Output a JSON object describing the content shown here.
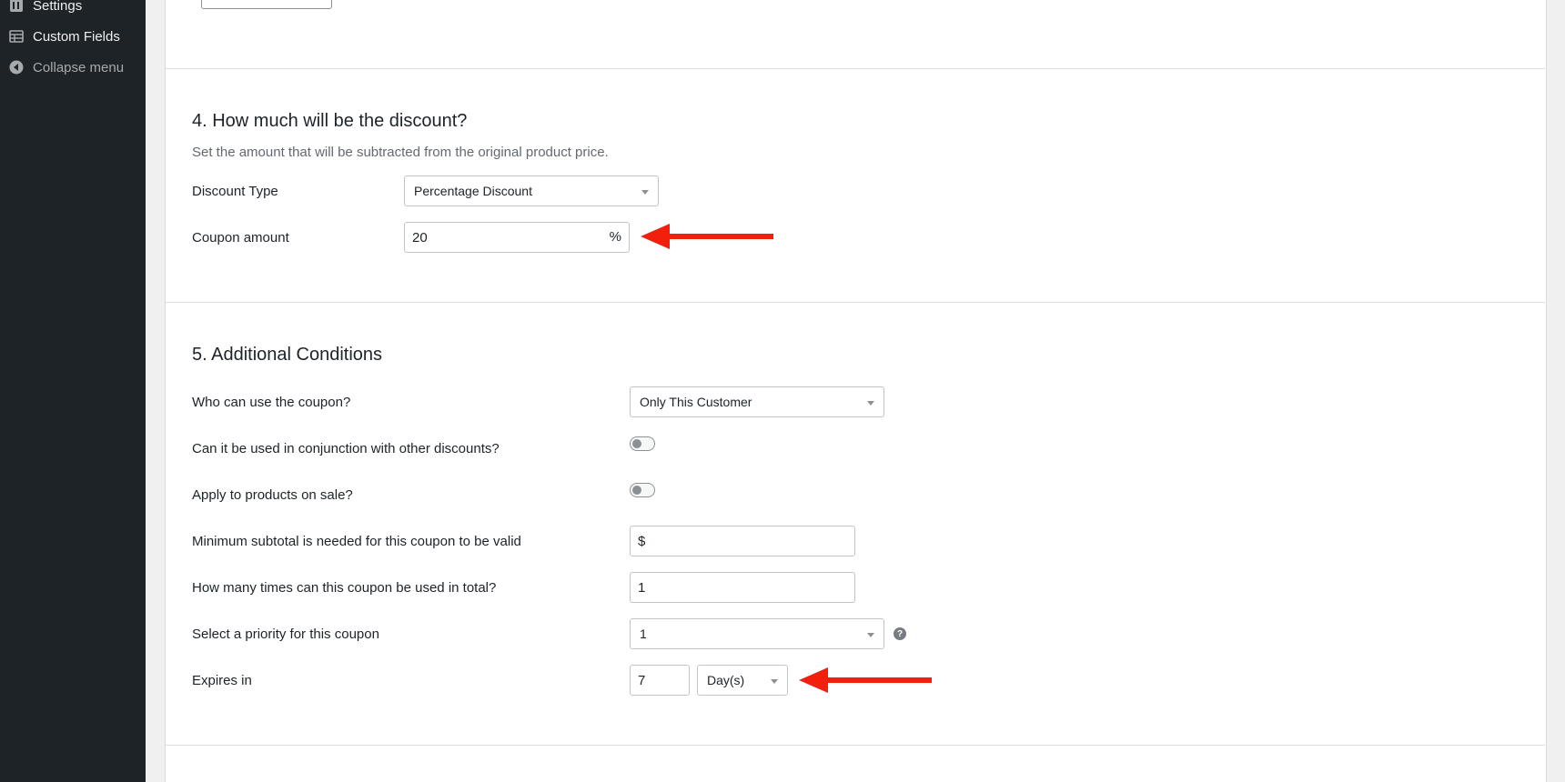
{
  "sidebar": {
    "items": [
      {
        "label": "Settings",
        "icon": "settings-icon"
      },
      {
        "label": "Custom Fields",
        "icon": "custom-fields-icon"
      },
      {
        "label": "Collapse menu",
        "icon": "collapse-icon"
      }
    ]
  },
  "section4": {
    "title": "4. How much will be the discount?",
    "description": "Set the amount that will be subtracted from the original product price.",
    "discount_type_label": "Discount Type",
    "discount_type_value": "Percentage Discount",
    "coupon_amount_label": "Coupon amount",
    "coupon_amount_value": "20",
    "coupon_amount_suffix": "%"
  },
  "section5": {
    "title": "5. Additional Conditions",
    "who_label": "Who can use the coupon?",
    "who_value": "Only This Customer",
    "conjunction_label": "Can it be used in conjunction with other discounts?",
    "conjunction_on": false,
    "sale_label": "Apply to products on sale?",
    "sale_on": false,
    "min_subtotal_label": "Minimum subtotal is needed for this coupon to be valid",
    "min_subtotal_value": "$",
    "usage_label": "How many times can this coupon be used in total?",
    "usage_value": "1",
    "priority_label": "Select a priority for this coupon",
    "priority_value": "1",
    "expires_label": "Expires in",
    "expires_value": "7",
    "expires_unit": "Day(s)"
  },
  "colors": {
    "sidebar_bg": "#1d2327",
    "annotation_arrow": "#f31f0d"
  }
}
